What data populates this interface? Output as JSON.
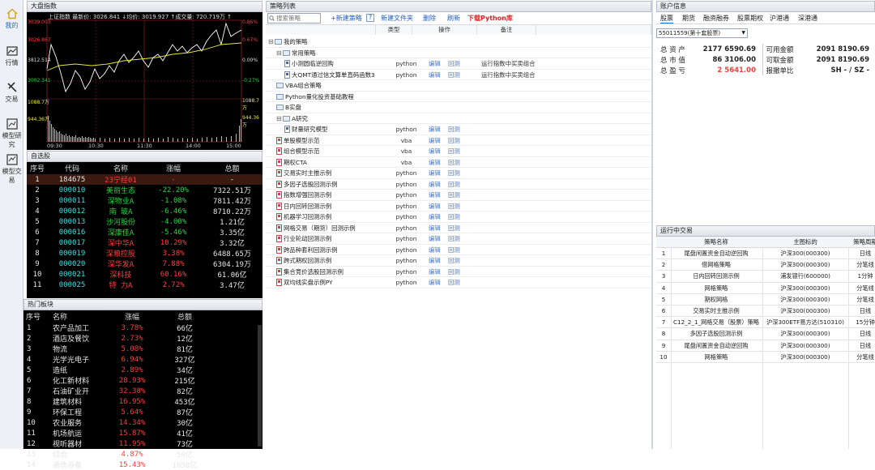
{
  "nav": [
    {
      "label": "我的",
      "icon": "home-icon"
    },
    {
      "label": "行情",
      "icon": "chart-icon"
    },
    {
      "label": "交易",
      "icon": "trade-icon"
    },
    {
      "label": "模型研究",
      "icon": "research-icon"
    },
    {
      "label": "模型交易",
      "icon": "model-trade-icon"
    }
  ],
  "index_panel": {
    "title": "大盘指数",
    "header": "上证指数  最新价: 3026.841  ↓均价: 3019.927  ↑成交量: 720.719万  ↑",
    "left_labels": [
      "3039.003",
      "3026.867",
      "3812.514",
      "3002.341",
      "1088.7万",
      "944.36万"
    ],
    "right_labels": [
      "0.86%",
      "0.67%",
      "0.00%",
      "-0.27%",
      "1088.7万",
      "944.36万"
    ],
    "time_labels": [
      "09:30",
      "10:30",
      "11:30",
      "14:00",
      "15:00"
    ]
  },
  "watchlist": {
    "title": "自选股",
    "columns": [
      "序号",
      "代码",
      "名称",
      "涨幅",
      "总额"
    ],
    "rows": [
      [
        "1",
        "184675",
        "23宁经01",
        "-",
        "-"
      ],
      [
        "2",
        "000010",
        "美丽生态",
        "-22.20%",
        "7322.51万"
      ],
      [
        "3",
        "000011",
        "深物业A",
        "-1.08%",
        "7811.42万"
      ],
      [
        "4",
        "000012",
        "南 玻A",
        "-6.46%",
        "8710.22万"
      ],
      [
        "5",
        "000013",
        "沙河股份",
        "-4.00%",
        "1.21亿"
      ],
      [
        "6",
        "000016",
        "深康佳A",
        "-5.46%",
        "3.35亿"
      ],
      [
        "7",
        "000017",
        "深中华A",
        "10.29%",
        "3.32亿"
      ],
      [
        "8",
        "000019",
        "深粮控股",
        "3.38%",
        "6488.65万"
      ],
      [
        "9",
        "000020",
        "深华发A",
        "7.88%",
        "6304.19万"
      ],
      [
        "10",
        "000021",
        "深科技",
        "60.16%",
        "61.06亿"
      ],
      [
        "11",
        "000025",
        "特 力A",
        "2.72%",
        "3.47亿"
      ]
    ]
  },
  "hot": {
    "title": "热门板块",
    "columns": [
      "序号",
      "名称",
      "涨幅",
      "总额"
    ],
    "rows": [
      [
        "1",
        "农产品加工",
        "3.78%",
        "66亿"
      ],
      [
        "2",
        "酒店及餐饮",
        "2.73%",
        "12亿"
      ],
      [
        "3",
        "物流",
        "5.08%",
        "81亿"
      ],
      [
        "4",
        "光学光电子",
        "6.94%",
        "327亿"
      ],
      [
        "5",
        "造纸",
        "2.89%",
        "34亿"
      ],
      [
        "6",
        "化工新材料",
        "28.93%",
        "215亿"
      ],
      [
        "7",
        "石油矿业开",
        "32.38%",
        "82亿"
      ],
      [
        "8",
        "建筑材料",
        "16.95%",
        "453亿"
      ],
      [
        "9",
        "环保工程",
        "5.64%",
        "87亿"
      ],
      [
        "10",
        "农业服务",
        "14.34%",
        "30亿"
      ],
      [
        "11",
        "机场航运",
        "15.87%",
        "41亿"
      ],
      [
        "12",
        "视听器材",
        "11.95%",
        "73亿"
      ],
      [
        "13",
        "综合",
        "4.87%",
        "50亿"
      ],
      [
        "14",
        "通信设备",
        "15.43%",
        "1058亿"
      ]
    ]
  },
  "strategy": {
    "title": "策略列表",
    "search_placeholder": "搜索策略",
    "toolbar": [
      "+新建策略",
      "?",
      "新建文件夹",
      "删除",
      "刷新",
      "下载Python库"
    ],
    "columns": [
      "",
      "类型",
      "操作",
      "备注"
    ],
    "rows": [
      {
        "name": "我的策略",
        "type": "",
        "op1": "",
        "op2": "",
        "note": "",
        "level": 0,
        "kind": "folder",
        "tog": "⊟"
      },
      {
        "name": "常用策略",
        "type": "",
        "op1": "",
        "op2": "",
        "note": "",
        "level": 1,
        "kind": "folder",
        "tog": "⊟"
      },
      {
        "name": "小测圆临逆回购",
        "type": "python",
        "op1": "编辑",
        "op2": "回测",
        "note": "运行指数中买卖组合",
        "level": 2,
        "kind": "file",
        "tog": ""
      },
      {
        "name": "大QMT通过信文算单直码函数3",
        "type": "python",
        "op1": "编辑",
        "op2": "回测",
        "note": "运行指数中买卖组合",
        "level": 2,
        "kind": "file",
        "tog": ""
      },
      {
        "name": "VBA组合策略",
        "type": "",
        "op1": "",
        "op2": "",
        "note": "",
        "level": 1,
        "kind": "folder",
        "tog": ""
      },
      {
        "name": "Python量化投资基础教程",
        "type": "",
        "op1": "",
        "op2": "",
        "note": "",
        "level": 1,
        "kind": "folder",
        "tog": ""
      },
      {
        "name": "B实盘",
        "type": "",
        "op1": "",
        "op2": "",
        "note": "",
        "level": 1,
        "kind": "folder",
        "tog": ""
      },
      {
        "name": "A研究",
        "type": "",
        "op1": "",
        "op2": "",
        "note": "",
        "level": 1,
        "kind": "folder",
        "tog": "⊟"
      },
      {
        "name": "财量研究模型",
        "type": "python",
        "op1": "编辑",
        "op2": "回测",
        "note": "",
        "level": 2,
        "kind": "file",
        "tog": ""
      },
      {
        "name": "单股模型示范",
        "type": "vba",
        "op1": "编辑",
        "op2": "回测",
        "note": "",
        "level": 1,
        "kind": "redfile",
        "tog": ""
      },
      {
        "name": "组合模型示范",
        "type": "vba",
        "op1": "编辑",
        "op2": "回测",
        "note": "",
        "level": 1,
        "kind": "redfile",
        "tog": ""
      },
      {
        "name": "期权CTA",
        "type": "vba",
        "op1": "编辑",
        "op2": "回测",
        "note": "",
        "level": 1,
        "kind": "redfile",
        "tog": ""
      },
      {
        "name": "交易实时主推示例",
        "type": "python",
        "op1": "编辑",
        "op2": "回测",
        "note": "",
        "level": 1,
        "kind": "redfile",
        "tog": ""
      },
      {
        "name": "多因子选股回测示例",
        "type": "python",
        "op1": "编辑",
        "op2": "回测",
        "note": "",
        "level": 1,
        "kind": "redfile",
        "tog": ""
      },
      {
        "name": "指数增强回测示例",
        "type": "python",
        "op1": "编辑",
        "op2": "回测",
        "note": "",
        "level": 1,
        "kind": "redfile",
        "tog": ""
      },
      {
        "name": "日内回转回测示例",
        "type": "python",
        "op1": "编辑",
        "op2": "回测",
        "note": "",
        "level": 1,
        "kind": "redfile",
        "tog": ""
      },
      {
        "name": "机器学习回测示例",
        "type": "python",
        "op1": "编辑",
        "op2": "回测",
        "note": "",
        "level": 1,
        "kind": "redfile",
        "tog": ""
      },
      {
        "name": "网格交易（期货）回测示例",
        "type": "python",
        "op1": "编辑",
        "op2": "回测",
        "note": "",
        "level": 1,
        "kind": "redfile",
        "tog": ""
      },
      {
        "name": "行业轮动回测示例",
        "type": "python",
        "op1": "编辑",
        "op2": "回测",
        "note": "",
        "level": 1,
        "kind": "redfile",
        "tog": ""
      },
      {
        "name": "跨品种套利回测示例",
        "type": "python",
        "op1": "编辑",
        "op2": "回测",
        "note": "",
        "level": 1,
        "kind": "redfile",
        "tog": ""
      },
      {
        "name": "跨式期权回测示例",
        "type": "python",
        "op1": "编辑",
        "op2": "回测",
        "note": "",
        "level": 1,
        "kind": "redfile",
        "tog": ""
      },
      {
        "name": "集合竞价选股回测示例",
        "type": "python",
        "op1": "编辑",
        "op2": "回测",
        "note": "",
        "level": 1,
        "kind": "redfile",
        "tog": ""
      },
      {
        "name": "双均线实盘示例PY",
        "type": "python",
        "op1": "编辑",
        "op2": "回测",
        "note": "",
        "level": 1,
        "kind": "redfile",
        "tog": ""
      }
    ]
  },
  "account": {
    "title": "账户信息",
    "tabs": [
      "股票",
      "期货",
      "融资融券",
      "股票期权",
      "沪港通",
      "深港通"
    ],
    "selector": "55011559(第十套股票)",
    "left": [
      [
        "总 资 产",
        "2177 6590.69"
      ],
      [
        "总 市 值",
        "86 3106.00"
      ],
      [
        "总 盈 亏",
        "2 5641.00"
      ]
    ],
    "right": [
      [
        "可用金额",
        "2091 8190.69"
      ],
      [
        "可取金额",
        "2091 8190.69"
      ],
      [
        "报撤单比",
        "SH - / SZ -"
      ]
    ]
  },
  "running": {
    "title": "运行中交易",
    "columns": [
      "",
      "策略名称",
      "主图标的",
      "策略周期"
    ],
    "rows": [
      [
        "1",
        "尾盘闲置资金自动逆回购",
        "沪深300(000300)",
        "日线"
      ],
      [
        "2",
        "借网格策略",
        "沪深300(000300)",
        "分笔线"
      ],
      [
        "3",
        "日内回转回测示例",
        "浦发银行(600000)",
        "1分钟"
      ],
      [
        "4",
        "网格策略",
        "沪深300(000300)",
        "分笔线"
      ],
      [
        "5",
        "期权网格",
        "沪深300(000300)",
        "分笔线"
      ],
      [
        "6",
        "交易实时主推示例",
        "沪深300(000300)",
        "日线"
      ],
      [
        "7",
        "C12_2_1_网格交易（股票）策略",
        "沪深300ETF易方达(510310)",
        "15分钟"
      ],
      [
        "8",
        "多因子选股回测示例",
        "沪深300(000300)",
        "日线"
      ],
      [
        "9",
        "尾盘闲置资金自动逆回购",
        "沪深300(000300)",
        "日线"
      ],
      [
        "10",
        "网格策略",
        "沪深300(000300)",
        "分笔线"
      ]
    ]
  },
  "colors": {
    "up": "#ff3c3c",
    "down": "#20d640",
    "code": "#33e0e6",
    "accent": "#1f6fd6"
  }
}
